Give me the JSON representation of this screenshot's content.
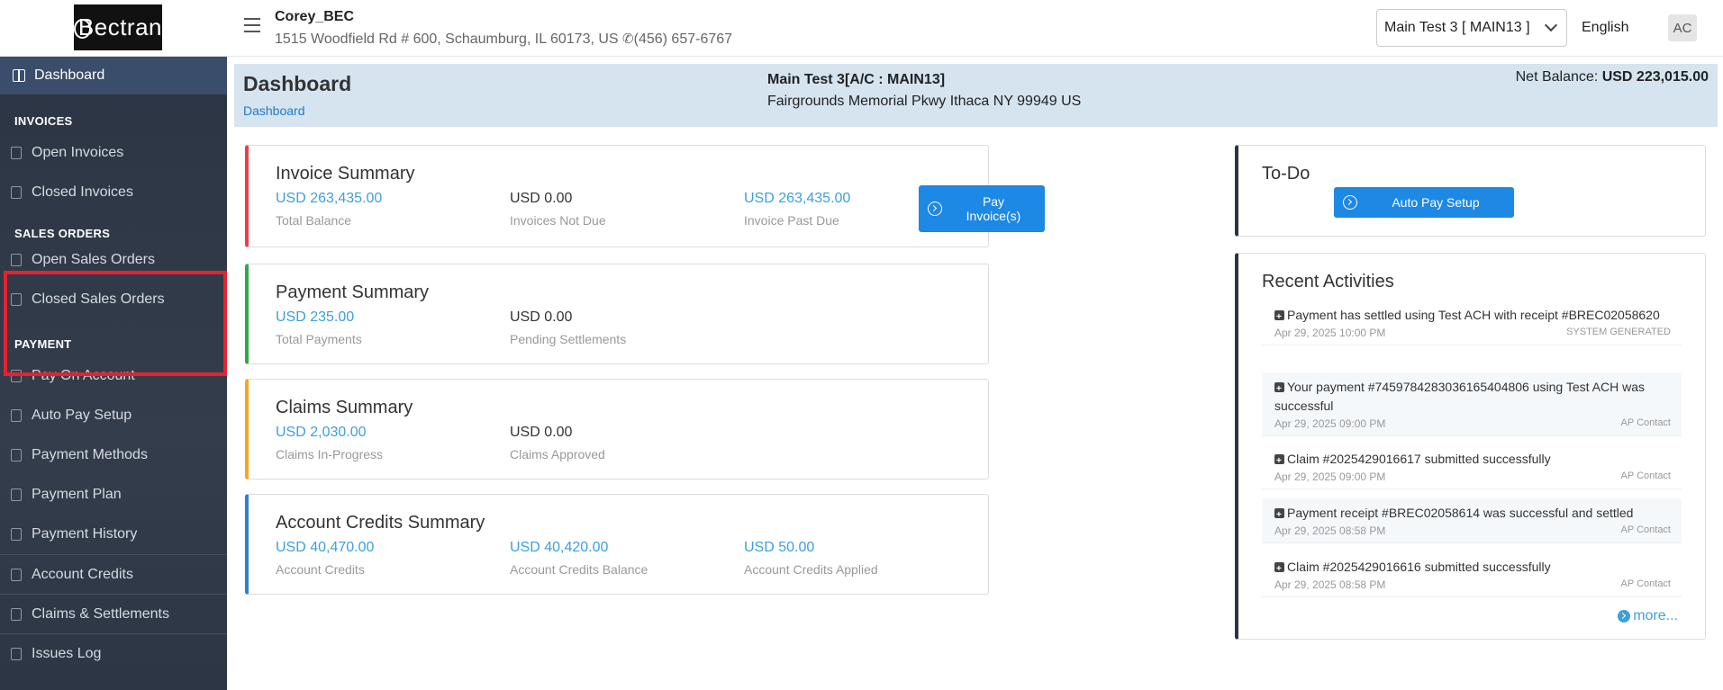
{
  "header": {
    "logo_text": "Bectran",
    "company_name": "Corey_BEC",
    "address": "1515 Woodfield Rd # 600, Schaumburg, IL 60173, US",
    "phone": "(456) 657-6767",
    "account_selected": "Main Test 3 [ MAIN13 ]",
    "language": "English",
    "avatar_initials": "AC"
  },
  "sidebar": {
    "dashboard": "Dashboard",
    "sections": [
      {
        "title": "INVOICES",
        "items": [
          "Open Invoices",
          "Closed Invoices"
        ]
      },
      {
        "title": "SALES ORDERS",
        "items": [
          "Open Sales Orders",
          "Closed Sales Orders"
        ]
      },
      {
        "title": "PAYMENT",
        "items": [
          "Pay On Account",
          "Auto Pay Setup",
          "Payment Methods",
          "Payment Plan",
          "Payment History",
          "Account Credits",
          "Claims & Settlements",
          "Issues Log"
        ]
      }
    ]
  },
  "banner": {
    "title": "Dashboard",
    "breadcrumb": "Dashboard",
    "account_line": "Main Test 3[A/C : MAIN13]",
    "address_line": "Fairgrounds Memorial Pkwy  Ithaca  NY 99949 US",
    "net_balance_label": "Net Balance:",
    "net_balance_value": "USD 223,015.00"
  },
  "cards": {
    "invoice": {
      "title": "Invoice Summary",
      "stats": [
        {
          "value": "USD 263,435.00",
          "label": "Total Balance"
        },
        {
          "value": "USD 0.00",
          "label": "Invoices Not Due"
        },
        {
          "value": "USD 263,435.00",
          "label": "Invoice Past Due"
        }
      ],
      "button_line1": "Pay",
      "button_line2": "Invoice(s)"
    },
    "payment": {
      "title": "Payment Summary",
      "stats": [
        {
          "value": "USD 235.00",
          "label": "Total Payments"
        },
        {
          "value": "USD 0.00",
          "label": "Pending Settlements"
        }
      ]
    },
    "claims": {
      "title": "Claims Summary",
      "stats": [
        {
          "value": "USD 2,030.00",
          "label": "Claims In-Progress"
        },
        {
          "value": "USD 0.00",
          "label": "Claims Approved"
        }
      ]
    },
    "credits": {
      "title": "Account Credits Summary",
      "stats": [
        {
          "value": "USD 40,470.00",
          "label": "Account Credits"
        },
        {
          "value": "USD 40,420.00",
          "label": "Account Credits Balance"
        },
        {
          "value": "USD 50.00",
          "label": "Account Credits Applied"
        }
      ]
    }
  },
  "todo": {
    "title": "To-Do",
    "button": "Auto Pay Setup"
  },
  "recent": {
    "title": "Recent Activities",
    "items": [
      {
        "text": "Payment has settled using Test ACH with receipt #BREC02058620",
        "date": "Apr 29, 2025 10:00 PM",
        "who": "SYSTEM GENERATED"
      },
      {
        "text": "Your payment #745978428303616540480​6 using Test ACH was successful",
        "date": "Apr 29, 2025 09:00 PM",
        "who": "AP Contact"
      },
      {
        "text": "Claim #2025429016617 submitted successfully",
        "date": "Apr 29, 2025 09:00 PM",
        "who": "AP Contact"
      },
      {
        "text": "Payment receipt #BREC02058614 was successful and settled",
        "date": "Apr 29, 2025 08:58 PM",
        "who": "AP Contact"
      },
      {
        "text": "Claim #2025429016616 submitted successfully",
        "date": "Apr 29, 2025 08:58 PM",
        "who": "AP Contact"
      }
    ],
    "more": "more..."
  },
  "colors": {
    "invoice_accent": "#e8404a",
    "payment_accent": "#2eaa4a",
    "claims_accent": "#f5a623",
    "credits_accent": "#2f80d1",
    "highlight_box": "#e8212e"
  }
}
